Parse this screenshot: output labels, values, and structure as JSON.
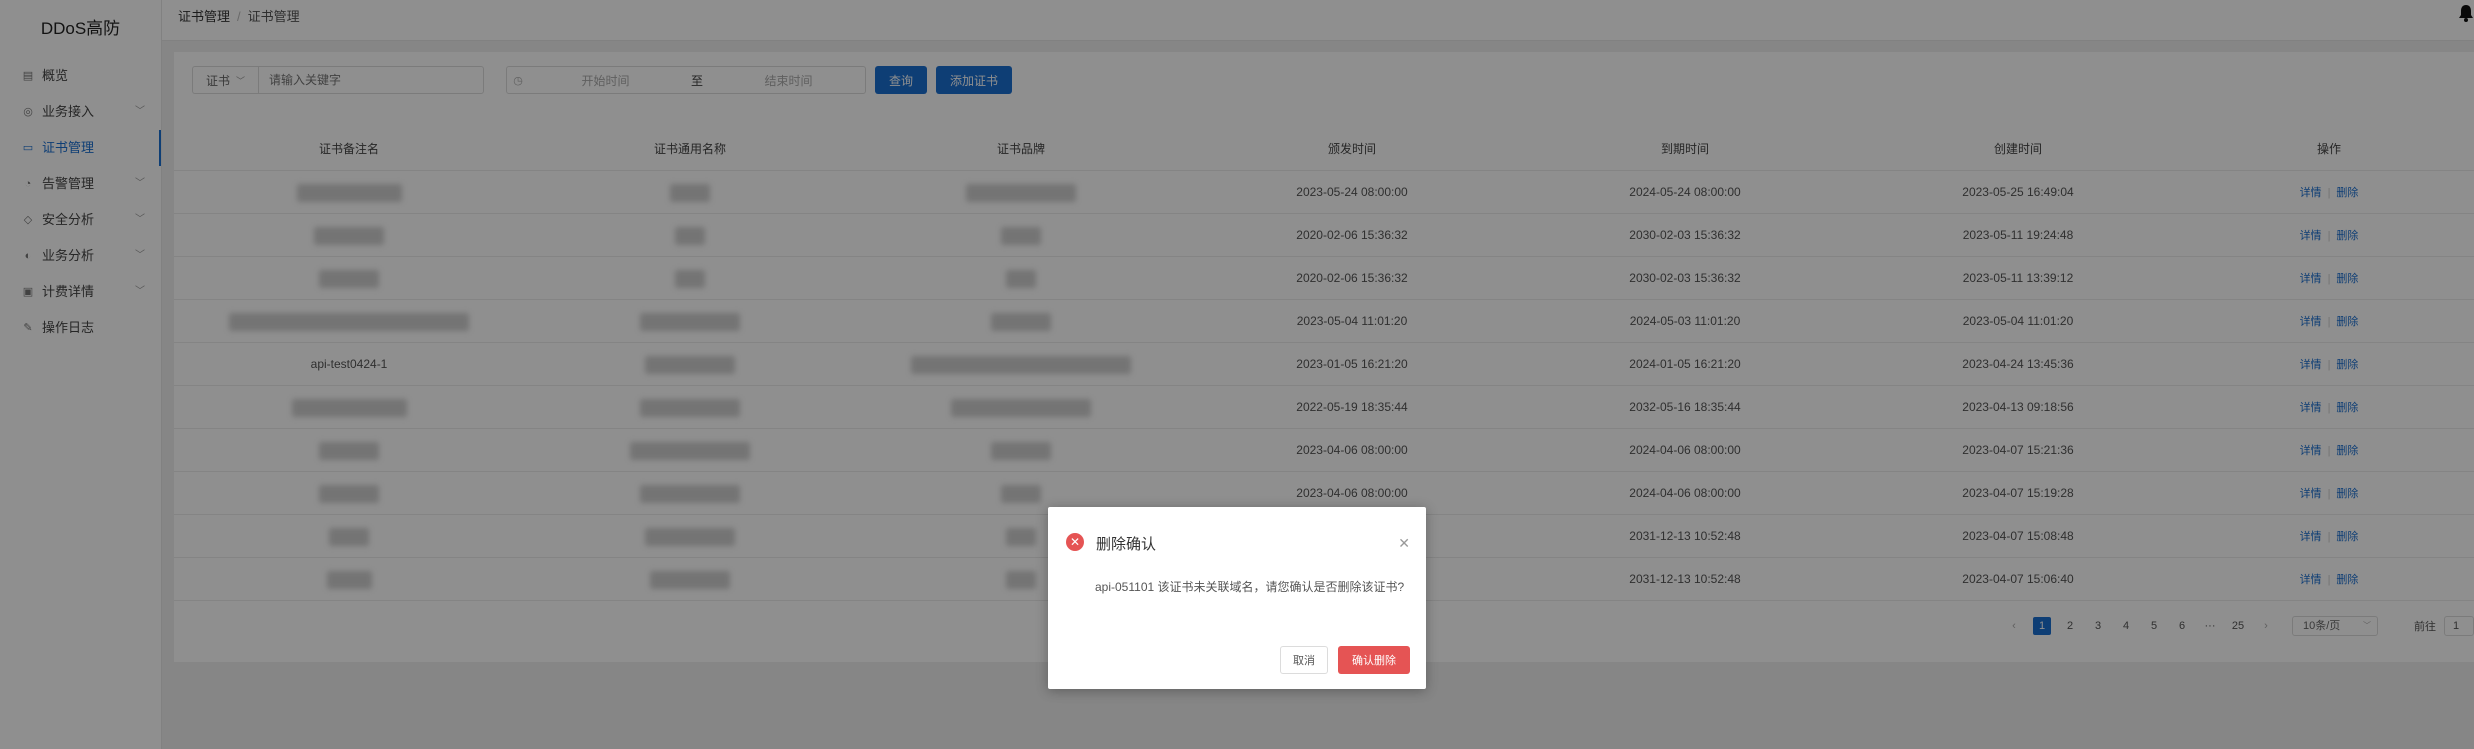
{
  "app": {
    "brand": "DDoS高防"
  },
  "sidebar": {
    "items": [
      {
        "label": "概览",
        "icon": "overview-icon",
        "chevron": false
      },
      {
        "label": "业务接入",
        "icon": "globe-icon",
        "chevron": true
      },
      {
        "label": "证书管理",
        "icon": "certificate-icon",
        "chevron": false,
        "active": true
      },
      {
        "label": "告警管理",
        "icon": "alarm-icon",
        "chevron": true
      },
      {
        "label": "安全分析",
        "icon": "shield-icon",
        "chevron": true
      },
      {
        "label": "业务分析",
        "icon": "chart-icon",
        "chevron": true
      },
      {
        "label": "计费详情",
        "icon": "billing-icon",
        "chevron": true
      },
      {
        "label": "操作日志",
        "icon": "log-icon",
        "chevron": false
      }
    ]
  },
  "breadcrumb": {
    "parent": "证书管理",
    "separator": "/",
    "current": "证书管理"
  },
  "toolbar": {
    "filter_select": "证书",
    "search_placeholder": "请输入关键字",
    "start_placeholder": "开始时间",
    "range_separator": "至",
    "end_placeholder": "结束时间",
    "query_button": "查询",
    "add_button": "添加证书"
  },
  "table": {
    "columns": [
      "证书备注名",
      "证书通用名称",
      "证书品牌",
      "颁发时间",
      "到期时间",
      "创建时间",
      "操作"
    ],
    "rows": [
      {
        "note": "",
        "common_name": "",
        "brand": "",
        "issued": "2023-05-24 08:00:00",
        "expires": "2024-05-24 08:00:00",
        "created": "2023-05-25 16:49:04"
      },
      {
        "note": "",
        "common_name": "",
        "brand": "",
        "issued": "2020-02-06 15:36:32",
        "expires": "2030-02-03 15:36:32",
        "created": "2023-05-11 19:24:48"
      },
      {
        "note": "",
        "common_name": "",
        "brand": "",
        "issued": "2020-02-06 15:36:32",
        "expires": "2030-02-03 15:36:32",
        "created": "2023-05-11 13:39:12"
      },
      {
        "note": "",
        "common_name": "",
        "brand": "",
        "issued": "2023-05-04 11:01:20",
        "expires": "2024-05-03 11:01:20",
        "created": "2023-05-04 11:01:20"
      },
      {
        "note": "api-test0424-1",
        "common_name": "",
        "brand": "",
        "issued": "2023-01-05 16:21:20",
        "expires": "2024-01-05 16:21:20",
        "created": "2023-04-24 13:45:36"
      },
      {
        "note": "",
        "common_name": "",
        "brand": "",
        "issued": "2022-05-19 18:35:44",
        "expires": "2032-05-16 18:35:44",
        "created": "2023-04-13 09:18:56"
      },
      {
        "note": "",
        "common_name": "",
        "brand": "",
        "issued": "2023-04-06 08:00:00",
        "expires": "2024-04-06 08:00:00",
        "created": "2023-04-07 15:21:36"
      },
      {
        "note": "",
        "common_name": "",
        "brand": "",
        "issued": "2023-04-06 08:00:00",
        "expires": "2024-04-06 08:00:00",
        "created": "2023-04-07 15:19:28"
      },
      {
        "note": "",
        "common_name": "",
        "brand": "",
        "issued": "",
        "expires": "2031-12-13 10:52:48",
        "created": "2023-04-07 15:08:48"
      },
      {
        "note": "",
        "common_name": "",
        "brand": "",
        "issued": "",
        "expires": "2031-12-13 10:52:48",
        "created": "2023-04-07 15:06:40"
      }
    ],
    "detail_label": "详情",
    "delete_label": "删除"
  },
  "pagination": {
    "pages": [
      "1",
      "2",
      "3",
      "4",
      "5",
      "6",
      "···",
      "25"
    ],
    "current": "1",
    "page_size": "10条/页",
    "goto_label": "前往",
    "goto_value": "1"
  },
  "dialog": {
    "title": "删除确认",
    "message": "api-051101 该证书未关联域名，请您确认是否删除该证书?",
    "cancel_label": "取消",
    "confirm_label": "确认删除",
    "danger_color": "#e55454"
  },
  "colors": {
    "accent": "#1a6fd1"
  }
}
